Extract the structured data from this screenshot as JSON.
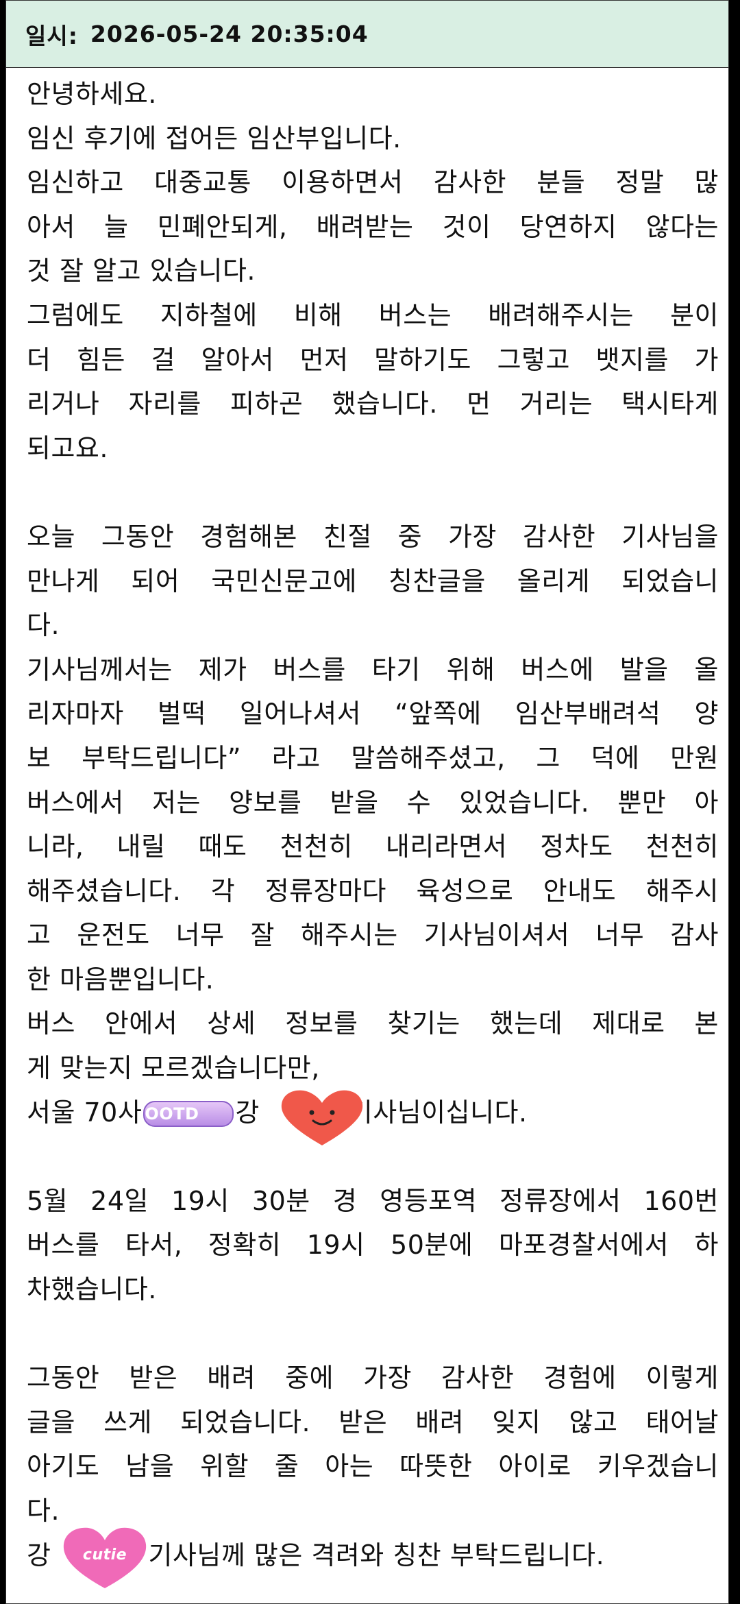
{
  "header": {
    "label": "일시:",
    "datetime": "2026-05-24 20:35:04"
  },
  "lines": [
    "안녕하세요.",
    "임신 후기에 접어든 임산부입니다.",
    "임신하고 대중교통 이용하면서 감사한 분들 정말 많",
    "아서 늘 민폐안되게, 배려받는 것이 당연하지 않다는",
    "것 잘 알고 있습니다.",
    "그럼에도 지하철에 비해 버스는 배려해주시는 분이",
    "더 힘든 걸 알아서 먼저 말하기도 그렇고 뱃지를 가",
    "리거나 자리를 피하곤 했습니다. 먼 거리는 택시타게",
    "되고요.",
    "",
    "오늘 그동안 경험해본 친절 중 가장 감사한 기사님을",
    "만나게 되어 국민신문고에 칭찬글을 올리게 되었습니",
    "다.",
    "기사님께서는 제가 버스를 타기 위해 버스에 발을 올",
    "리자마자 벌떡 일어나셔서 “앞쪽에 임산부배려석 양",
    "보 부탁드립니다” 라고 말씀해주셨고, 그 덕에 만원",
    "버스에서 저는 양보를 받을 수 있었습니다. 뿐만 아",
    "니라, 내릴 때도 천천히 내리라면서 정차도 천천히",
    "해주셨습니다. 각 정류장마다 육성으로 안내도 해주시",
    "고 운전도 너무 잘 해주시는 기사님이셔서 너무 감사",
    "한 마음뿐입니다.",
    "버스 안에서 상세 정보를 찾기는 했는데 제대로 본",
    "게 맞는지 모르겠습니다만,"
  ],
  "bus_line": {
    "prefix": "서울 70사",
    "mid": "강",
    "suffix": "기사님이십니다."
  },
  "lines2": [
    "",
    "5월 24일 19시 30분 경 영등포역 정류장에서 160번",
    "버스를 타서, 정확히 19시 50분에 마포경찰서에서 하",
    "차했습니다.",
    "",
    "그동안 받은 배려 중에 가장 감사한 경험에 이렇게",
    "글을 쓰게 되었습니다. 받은 배려 잊지 않고 태어날",
    "아기도 남을 위할 줄 아는 따뜻한 아이로 키우겠습니",
    "다."
  ],
  "last_line": {
    "prefix": "강",
    "suffix": "기사님께 많은 격려와 칭찬 부탁드립니다."
  },
  "stickers": {
    "ootd_text": "OOTD",
    "cutie_text": "cutie",
    "heart_color": "#f0584a",
    "cutie_color": "#f06ab8"
  }
}
